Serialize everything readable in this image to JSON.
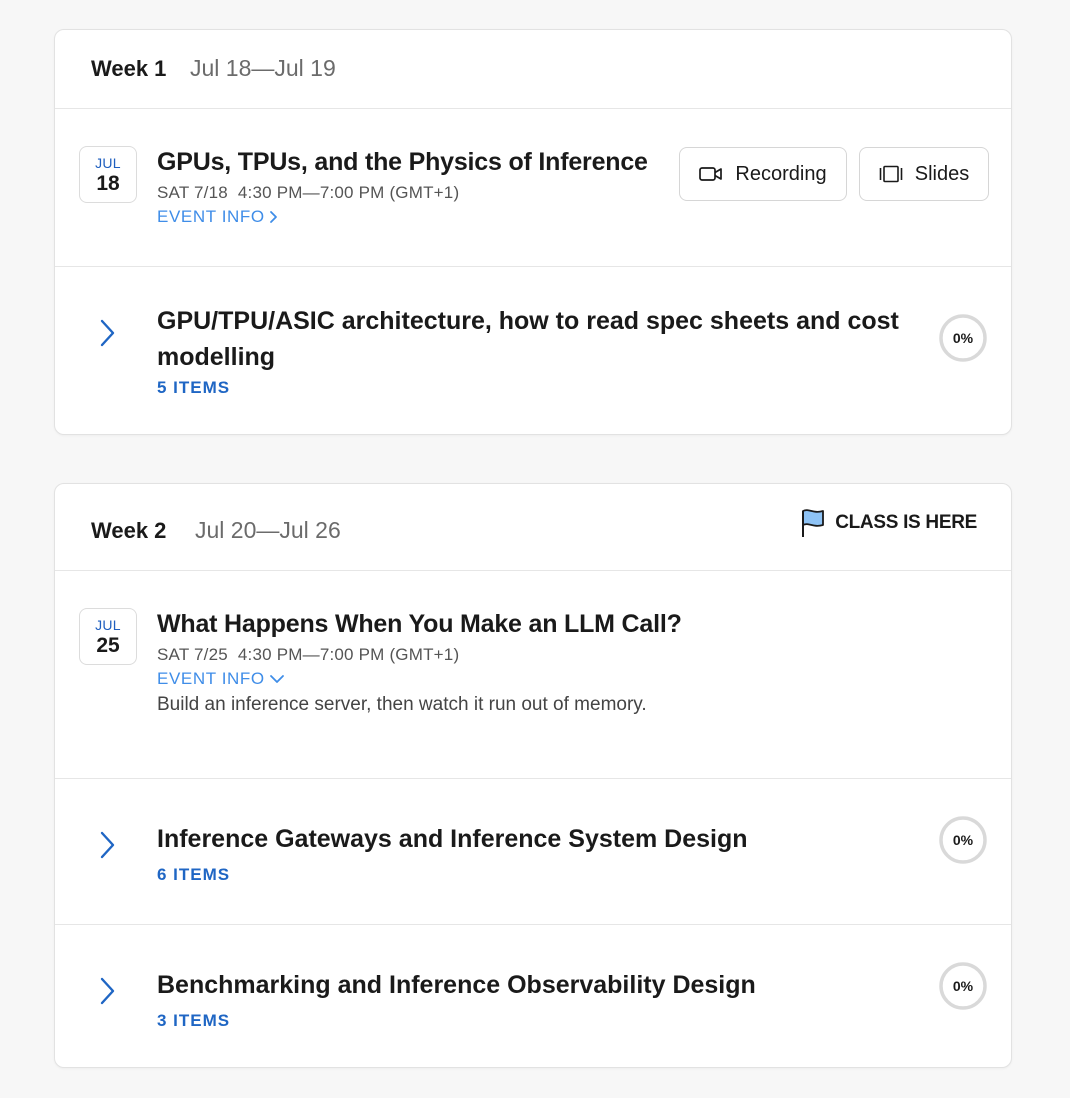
{
  "colors": {
    "accent_link": "#3f8de8",
    "accent_count": "#1f66c4",
    "flag_fill": "#8ec3f5",
    "progress_ring": "#d9d9d9"
  },
  "weeks": [
    {
      "title": "Week 1",
      "dates": "Jul 18—Jul 19",
      "event": {
        "month": "JUL",
        "day": "18",
        "title": "GPUs, TPUs, and the Physics of Inference",
        "date": "SAT 7/18",
        "time": "4:30 PM—7:00 PM (GMT+1)",
        "info_label": "EVENT INFO",
        "info_icon": "chevron-right-icon",
        "buttons": [
          {
            "label": "Recording",
            "icon": "video-camera-icon"
          },
          {
            "label": "Slides",
            "icon": "slides-icon"
          }
        ]
      },
      "modules": [
        {
          "title": "GPU/TPU/ASIC architecture, how to read spec sheets and cost modelling",
          "count": "5 ITEMS",
          "progress": "0%",
          "progress_value": 0
        }
      ]
    },
    {
      "title": "Week 2",
      "dates": "Jul 20—Jul 26",
      "status": {
        "label": "CLASS IS HERE",
        "icon": "flag-icon"
      },
      "event": {
        "month": "JUL",
        "day": "25",
        "title": "What Happens When You Make an LLM Call?",
        "date": "SAT 7/25",
        "time": "4:30 PM—7:00 PM (GMT+1)",
        "info_label": "EVENT INFO",
        "info_icon": "chevron-down-icon",
        "description": "Build an inference server, then watch it run out of memory."
      },
      "modules": [
        {
          "title": "Inference Gateways and Inference System Design",
          "count": "6 ITEMS",
          "progress": "0%",
          "progress_value": 0
        },
        {
          "title": "Benchmarking and Inference Observability Design",
          "count": "3 ITEMS",
          "progress": "0%",
          "progress_value": 0
        }
      ]
    }
  ]
}
